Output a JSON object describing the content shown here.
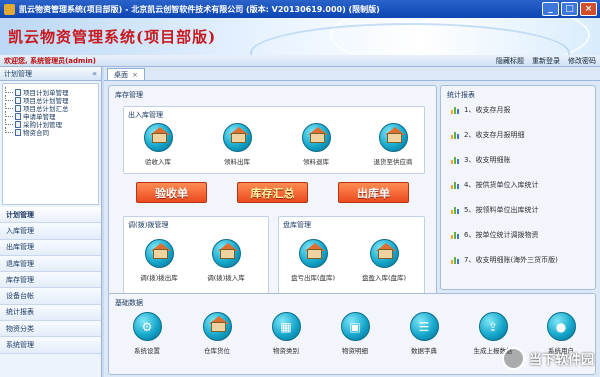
{
  "window": {
    "title": "凯云物资管理系统(项目部版) - 北京凯云创智软件技术有限公司 (版本: V20130619.000) (限制版)",
    "controls": [
      "_",
      "□",
      "×"
    ]
  },
  "banner": {
    "app_title": "凯云物资管理系统(项目部版)"
  },
  "header": {
    "welcome": "欢迎您, 系统管理员(admin)",
    "links": [
      "隐藏标题",
      "重新登录",
      "修改密码"
    ]
  },
  "sidebar": {
    "title": "计划管理",
    "collapse": "«",
    "tree": [
      "项目计划单管理",
      "项目总计划管理",
      "项目总计划汇总",
      "申请单管理",
      "采购计划管理",
      "物资合同"
    ],
    "menu": [
      "计划管理",
      "入库管理",
      "出库管理",
      "退库管理",
      "库存管理",
      "设备台帐",
      "统计报表",
      "物资分类",
      "系统管理"
    ]
  },
  "tabs": [
    {
      "label": "桌面",
      "close": "×"
    }
  ],
  "inventory": {
    "title": "库存管理",
    "in_out": {
      "title": "出入库管理",
      "buttons": [
        "验收入库",
        "领料出库",
        "领料退库",
        "退货至供应商"
      ]
    },
    "orange_buttons": [
      "验收单",
      "库存汇总",
      "出库单"
    ],
    "transfer": {
      "title": "调(拨)拨管理",
      "buttons": [
        "调(拨)拨出库",
        "调(拨)拨入库"
      ]
    },
    "count": {
      "title": "盘库管理",
      "buttons": [
        "盘亏出库(盘库)",
        "盘盈入库(盘库)"
      ]
    }
  },
  "stats": {
    "title": "统计报表",
    "items": [
      "1、收支存月报",
      "2、收支存月报明细",
      "3、收支明细账",
      "4、按供货单位入库统计",
      "5、按领料单位出库统计",
      "6、按单位统计调拨物资",
      "7、收支明细账(海外三货币版)"
    ]
  },
  "basic": {
    "title": "基础数据",
    "items": [
      "系统设置",
      "仓库货位",
      "物资类别",
      "物资明细",
      "数据字典",
      "生成上报数据",
      "系统用户"
    ]
  },
  "watermark": {
    "text": "当下软件园"
  }
}
